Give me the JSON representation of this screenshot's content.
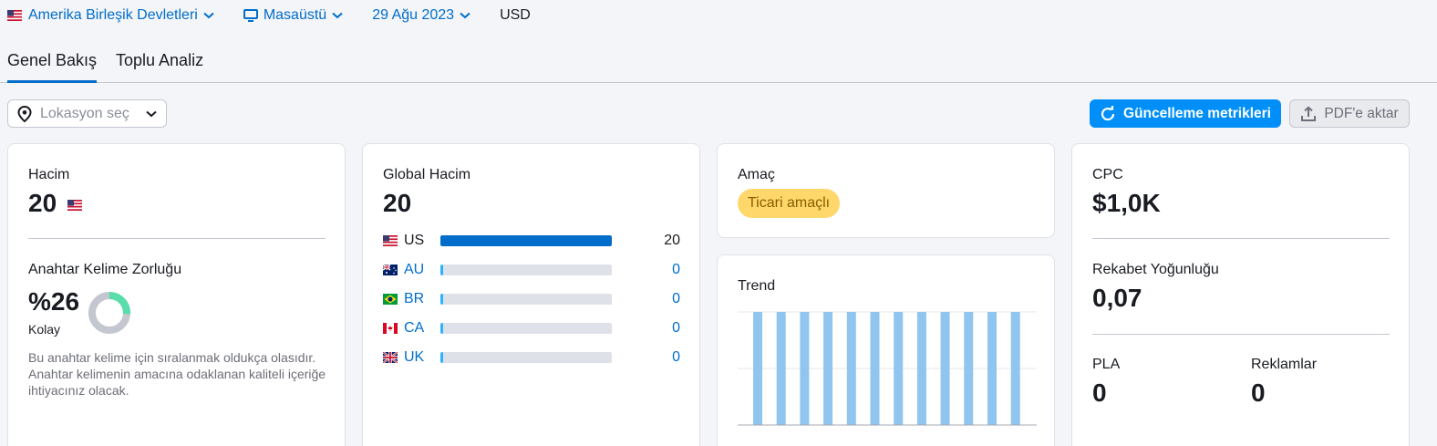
{
  "filters": {
    "country": "Amerika Birleşik Devletleri",
    "device": "Masaüstü",
    "date": "29 Ağu 2023",
    "currency": "USD"
  },
  "tabs": [
    {
      "label": "Genel Bakış",
      "active": true
    },
    {
      "label": "Toplu Analiz",
      "active": false
    }
  ],
  "actions": {
    "location_placeholder": "Lokasyon seç",
    "update_metrics": "Güncelleme metrikleri",
    "export_pdf": "PDF'e aktar"
  },
  "volume": {
    "label": "Hacim",
    "value": "20"
  },
  "keyword_difficulty": {
    "label": "Anahtar Kelime Zorluğu",
    "value": "%26",
    "percent": 26,
    "level": "Kolay",
    "note": "Bu anahtar kelime için sıralanmak oldukça olasıdır. Anahtar kelimenin amacına odaklanan kaliteli içeriğe ihtiyacınız olacak."
  },
  "global_volume": {
    "label": "Global Hacim",
    "value": "20",
    "rows": [
      {
        "code": "US",
        "value": "20",
        "share": 1.0
      },
      {
        "code": "AU",
        "value": "0",
        "share": 0
      },
      {
        "code": "BR",
        "value": "0",
        "share": 0
      },
      {
        "code": "CA",
        "value": "0",
        "share": 0
      },
      {
        "code": "UK",
        "value": "0",
        "share": 0
      }
    ]
  },
  "intent": {
    "label": "Amaç",
    "badge": "Ticari amaçlı"
  },
  "trend": {
    "label": "Trend",
    "values": [
      1,
      1,
      1,
      1,
      1,
      1,
      1,
      1,
      1,
      1,
      1,
      1
    ]
  },
  "cpc": {
    "label": "CPC",
    "value": "$1,0K"
  },
  "competition": {
    "label": "Rekabet Yoğunluğu",
    "value": "0,07"
  },
  "pla": {
    "label": "PLA",
    "value": "0"
  },
  "ads": {
    "label": "Reklamlar",
    "value": "0"
  },
  "colors": {
    "accent": "#006dca",
    "primary_button": "#008ff8",
    "kd_easy": "#59ddaa",
    "trend_bar": "#8fc5ef",
    "intent_badge": "#ffd76a"
  }
}
